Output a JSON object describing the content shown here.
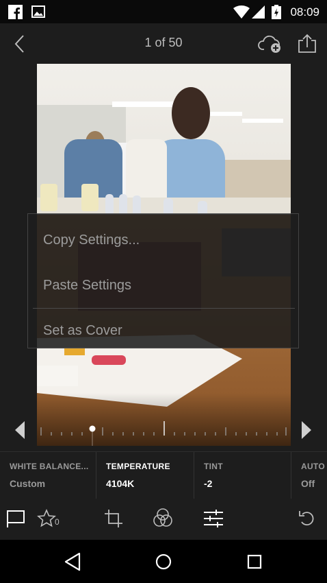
{
  "status_bar": {
    "time": "08:09",
    "icons": [
      "facebook-icon",
      "gallery-icon",
      "wifi-icon",
      "signal-icon",
      "battery-icon"
    ]
  },
  "app_bar": {
    "page_counter": "1 of 50",
    "icons": [
      "back-icon",
      "cloud-add-icon",
      "share-icon"
    ]
  },
  "context_menu": {
    "items": [
      "Copy Settings...",
      "Paste Settings",
      "Set as Cover"
    ]
  },
  "white_balance": {
    "columns": [
      {
        "label": "WHITE BALANCE...",
        "value": "Custom"
      },
      {
        "label": "TEMPERATURE",
        "value": "4104K"
      },
      {
        "label": "TINT",
        "value": "-2"
      },
      {
        "label": "AUTO T",
        "value": "Off"
      }
    ],
    "active_column": "TEMPERATURE"
  },
  "bottom_toolbar": {
    "rating": "0",
    "icons": [
      "flag-icon",
      "star-icon",
      "crop-icon",
      "presets-icon",
      "adjust-icon",
      "undo-icon"
    ]
  },
  "nav_bar": {
    "icons": [
      "back-triangle-icon",
      "home-circle-icon",
      "recents-square-icon"
    ]
  },
  "colors": {
    "background": "#1d1d1d",
    "menu_text": "#9c9c9c",
    "label_dim": "#9a9a9a",
    "label_active": "#ffffff"
  }
}
